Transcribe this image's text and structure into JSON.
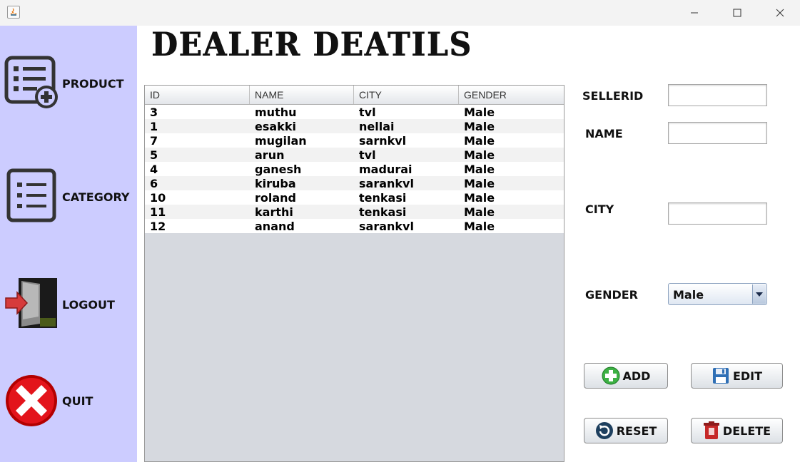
{
  "window": {
    "minimize_glyph": "—",
    "maximize_glyph": "☐",
    "close_glyph": "✕"
  },
  "sidebar": {
    "items": [
      {
        "label": "PRODUCT",
        "icon": "product-list-add-icon"
      },
      {
        "label": "CATEGORY",
        "icon": "category-list-icon"
      },
      {
        "label": "LOGOUT",
        "icon": "logout-door-icon"
      },
      {
        "label": "QUIT",
        "icon": "quit-x-icon"
      }
    ]
  },
  "main": {
    "title": "DEALER DEATILS"
  },
  "table": {
    "columns": [
      "ID",
      "NAME",
      "CITY",
      "GENDER"
    ],
    "rows": [
      [
        "3",
        "muthu",
        "tvl",
        "Male"
      ],
      [
        "1",
        "esakki",
        "nellai",
        "Male"
      ],
      [
        "7",
        "mugilan",
        "sarnkvl",
        "Male"
      ],
      [
        "5",
        "arun",
        "tvl",
        "Male"
      ],
      [
        "4",
        "ganesh",
        "madurai",
        "Male"
      ],
      [
        "6",
        "kiruba",
        "sarankvl",
        "Male"
      ],
      [
        "10",
        "roland",
        "tenkasi",
        "Male"
      ],
      [
        "11",
        "karthi",
        "tenkasi",
        "Male"
      ],
      [
        "12",
        "anand",
        "sarankvl",
        "Male"
      ]
    ]
  },
  "form": {
    "sellerid_label": "SELLERID",
    "sellerid_value": "",
    "name_label": "NAME",
    "name_value": "",
    "city_label": "CITY",
    "city_value": "",
    "gender_label": "GENDER",
    "gender_value": "Male"
  },
  "buttons": {
    "add": "ADD",
    "edit": "EDIT",
    "reset": "RESET",
    "delete": "DELETE"
  },
  "colors": {
    "sidebar_bg": "#ccccff",
    "quit_red": "#e3141b",
    "add_green": "#3cb043"
  }
}
